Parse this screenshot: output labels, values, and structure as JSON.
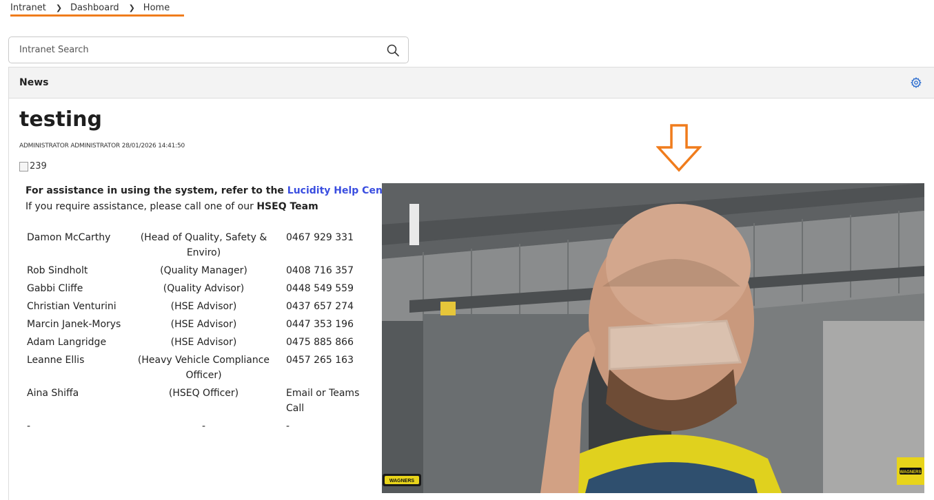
{
  "breadcrumb": {
    "items": [
      "Intranet",
      "Dashboard",
      "Home"
    ]
  },
  "search": {
    "placeholder": "Intranet Search"
  },
  "panel": {
    "title": "News"
  },
  "article": {
    "title": "testing",
    "meta": "ADMINISTRATOR ADMINISTRATOR 28/01/2026 14:41:50",
    "broken_image_alt": "239",
    "assist_line1_prefix": "For assistance in using the system, refer to the ",
    "assist_link": "Lucidity Help Centre",
    "assist_line1_suffix": ".",
    "assist_line2_prefix": "If you require assistance, please call one of our ",
    "assist_line2_bold": "HSEQ Team"
  },
  "contacts": [
    {
      "name": "Damon McCarthy",
      "role": "(Head of Quality, Safety & Enviro)",
      "phone": "0467 929 331"
    },
    {
      "name": "Rob Sindholt",
      "role": "(Quality Manager)",
      "phone": "0408 716 357"
    },
    {
      "name": "Gabbi Cliffe",
      "role": "(Quality Advisor)",
      "phone": "0448 549 559"
    },
    {
      "name": "Christian Venturini",
      "role": "(HSE Advisor)",
      "phone": "0437 657 274"
    },
    {
      "name": "Marcin Janek-Morys",
      "role": "(HSE Advisor)",
      "phone": "0447 353 196"
    },
    {
      "name": "Adam Langridge",
      "role": "(HSE Advisor)",
      "phone": "0475 885 866"
    },
    {
      "name": "Leanne Ellis",
      "role": "(Heavy Vehicle Compliance Officer)",
      "phone": "0457 265 163"
    },
    {
      "name": "Aina Shiffa",
      "role": "(HSEQ Officer)",
      "phone": "Email or Teams Call"
    },
    {
      "name": "-",
      "role": "-",
      "phone": "-"
    }
  ],
  "photo": {
    "logo_text": "WAGNERS"
  },
  "colors": {
    "accent_orange": "#f07c1c",
    "link_blue": "#3a4ee0",
    "gear_blue": "#2f6fd0",
    "logo_yellow": "#e8d41a"
  },
  "icons": [
    "chevron-right-icon",
    "search-icon",
    "gear-icon",
    "arrow-down-icon",
    "broken-image-icon"
  ]
}
